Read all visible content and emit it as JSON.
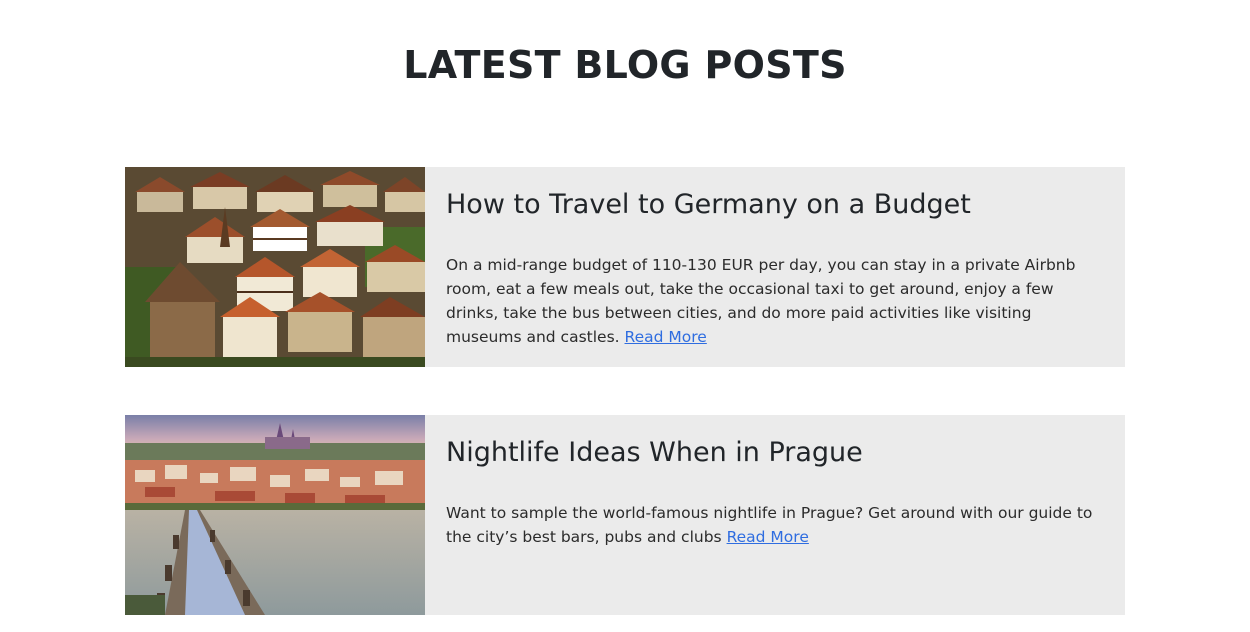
{
  "section": {
    "title": "LATEST BLOG POSTS"
  },
  "posts": [
    {
      "image_alt": "German town rooftops",
      "title": "How to Travel to Germany on a Budget",
      "excerpt": "On a mid-range budget of 110-130 EUR per day, you can stay in a private Airbnb room, eat a few meals out, take the occasional taxi to get around, enjoy a few drinks, take the bus between cities, and do more paid activities like visiting museums and castles.",
      "link_label": "Read More"
    },
    {
      "image_alt": "Prague Charles Bridge at dusk",
      "title": "Nightlife Ideas When in Prague",
      "excerpt": "Want to sample the world-famous nightlife in Prague? Get around with our guide to the city’s best bars, pubs and clubs",
      "link_label": "Read More"
    }
  ],
  "colors": {
    "card_background": "#ebebeb",
    "link": "#2f6de0",
    "text": "#212529"
  }
}
